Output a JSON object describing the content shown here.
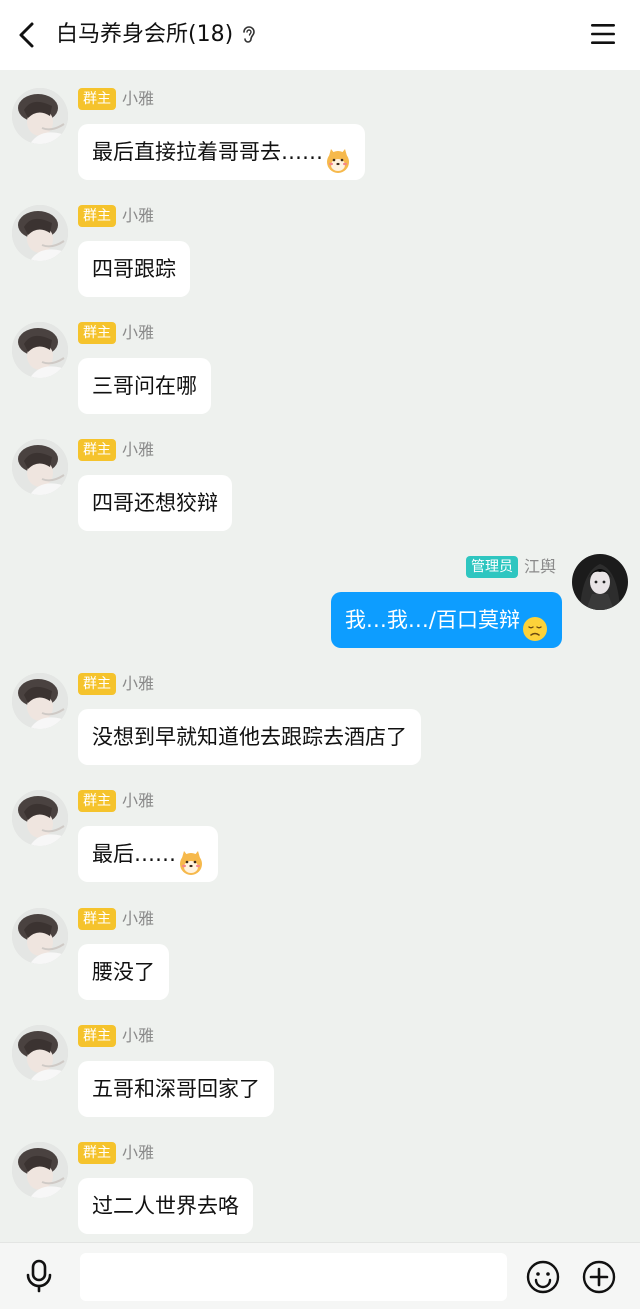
{
  "header": {
    "title": "白马养身会所(18)",
    "back_icon": "chevron-left-icon",
    "ear_icon": "ear-icon",
    "menu_icon": "hamburger-menu-icon"
  },
  "colors": {
    "background": "#eef1ee",
    "out_bubble": "#0d9dff",
    "owner_badge": "#f5c32c",
    "admin_badge": "#2ec6c0"
  },
  "messages": [
    {
      "side": "in",
      "badge": "群主",
      "nick": "小雅",
      "text": "最后直接拉着哥哥去……",
      "emoji": "shiba-emoji"
    },
    {
      "side": "in",
      "badge": "群主",
      "nick": "小雅",
      "text": "四哥跟踪"
    },
    {
      "side": "in",
      "badge": "群主",
      "nick": "小雅",
      "text": "三哥问在哪"
    },
    {
      "side": "in",
      "badge": "群主",
      "nick": "小雅",
      "text": "四哥还想狡辩"
    },
    {
      "side": "out",
      "badge": "管理员",
      "nick": "江舆",
      "text": "我…我…/百口莫辩",
      "emoji": "sad-face-emoji"
    },
    {
      "side": "in",
      "badge": "群主",
      "nick": "小雅",
      "text": "没想到早就知道他去跟踪去酒店了"
    },
    {
      "side": "in",
      "badge": "群主",
      "nick": "小雅",
      "text": "最后……",
      "emoji": "shiba-emoji"
    },
    {
      "side": "in",
      "badge": "群主",
      "nick": "小雅",
      "text": "腰没了"
    },
    {
      "side": "in",
      "badge": "群主",
      "nick": "小雅",
      "text": "五哥和深哥回家了"
    },
    {
      "side": "in",
      "badge": "群主",
      "nick": "小雅",
      "text": "过二人世界去咯"
    }
  ],
  "input_bar": {
    "message_value": "",
    "mic_icon": "microphone-icon",
    "emoji_icon": "smiley-icon",
    "plus_icon": "plus-circle-icon"
  }
}
